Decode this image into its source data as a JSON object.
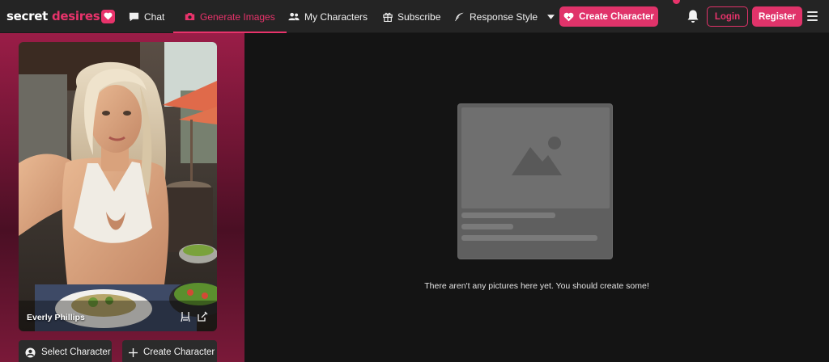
{
  "logo": {
    "word1": "secret",
    "word2": "desires"
  },
  "nav": {
    "items": [
      {
        "label": "Chat",
        "icon": "chat-bubble-icon",
        "active": false
      },
      {
        "label": "Generate Images",
        "icon": "camera-icon",
        "active": true
      },
      {
        "label": "My Characters",
        "icon": "users-icon",
        "active": false
      },
      {
        "label": "Subscribe",
        "icon": "gift-icon",
        "active": false
      },
      {
        "label": "Response Style",
        "icon": "feather-icon",
        "active": false
      }
    ],
    "create_character": "Create Character",
    "login": "Login",
    "register": "Register"
  },
  "character": {
    "name": "Everly Phillips"
  },
  "left_actions": {
    "select_character": "Select Character",
    "create_character": "Create Character"
  },
  "main": {
    "empty_message": "There aren't any pictures here yet. You should create some!"
  },
  "colors": {
    "accent": "#e0336a",
    "background": "#141414",
    "navbar": "#242424",
    "panel_gradient_top": "#9a1d47"
  }
}
